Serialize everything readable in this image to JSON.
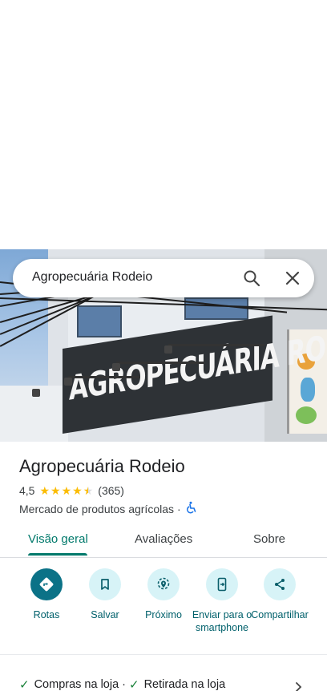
{
  "search": {
    "query": "Agropecuária Rodeio"
  },
  "hero": {
    "sign_text": "AGROPECUÁRIA RODEIO"
  },
  "place": {
    "name": "Agropecuária Rodeio",
    "rating": "4,5",
    "rating_value": 4.5,
    "review_count": "(365)",
    "category": "Mercado de produtos agrícolas",
    "separator": "·",
    "accessibility_icon": "wheelchair-icon"
  },
  "tabs": [
    {
      "label": "Visão geral",
      "active": true
    },
    {
      "label": "Avaliações",
      "active": false
    },
    {
      "label": "Sobre",
      "active": false
    }
  ],
  "actions": [
    {
      "label": "Rotas",
      "icon": "directions-icon"
    },
    {
      "label": "Salvar",
      "icon": "bookmark-icon"
    },
    {
      "label": "Próximo",
      "icon": "nearby-icon"
    },
    {
      "label": "Enviar para o smartphone",
      "icon": "send-to-phone-icon"
    },
    {
      "label": "Compartilhar",
      "icon": "share-icon"
    }
  ],
  "services": [
    {
      "label": "Compras na loja"
    },
    {
      "label": "Retirada na loja"
    }
  ],
  "colors": {
    "accent": "#00796b",
    "star": "#fbbc04",
    "check": "#188038",
    "action_bg": "#d7f3f7",
    "primary_action": "#0b7287"
  }
}
